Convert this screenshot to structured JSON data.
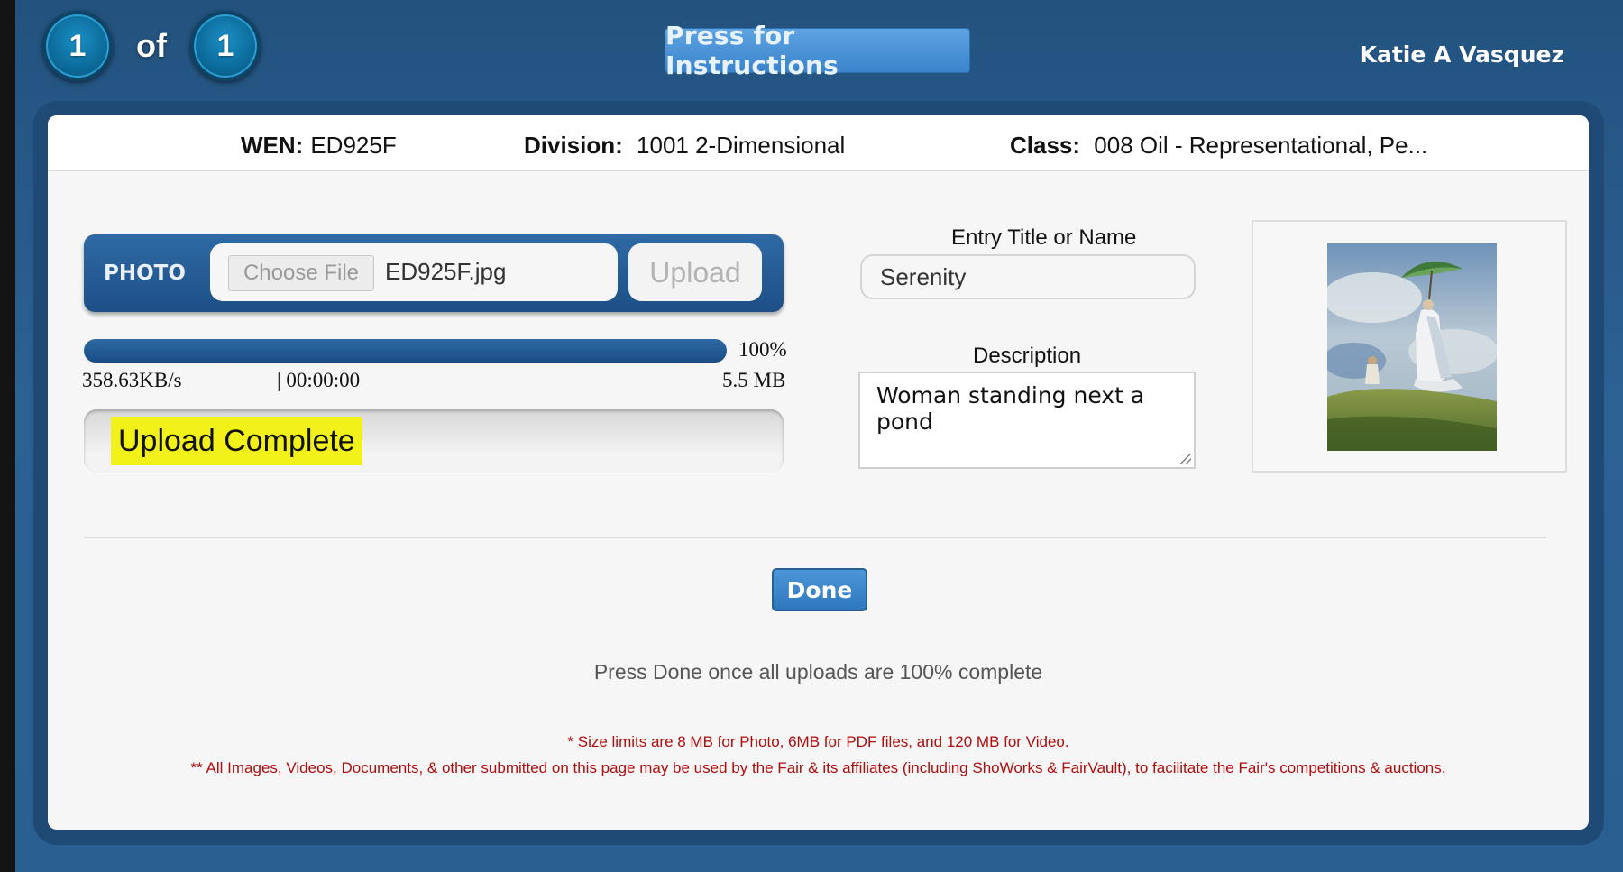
{
  "header": {
    "current_index": "1",
    "of_label": "of",
    "total_count": "1",
    "instructions_button": "Press for Instructions",
    "user_name": "Katie A Vasquez"
  },
  "entry_info": {
    "wen_label": "WEN:",
    "wen_value": "ED925F",
    "division_label": "Division:",
    "division_value": "1001 2-Dimensional",
    "class_label": "Class:",
    "class_value": "008 Oil - Representational, Pe..."
  },
  "upload": {
    "photo_label": "PHOTO",
    "choose_file_button": "Choose File",
    "file_name": "ED925F.jpg",
    "upload_button": "Upload",
    "progress_percent": "100%",
    "progress_fraction": 1.0,
    "speed": "358.63KB/s",
    "elapsed": "| 00:00:00",
    "file_size": "5.5 MB",
    "status": "Upload Complete",
    "status_highlight_color": "#f2f21a"
  },
  "form": {
    "title_label": "Entry Title or Name",
    "title_value": "Serenity",
    "description_label": "Description",
    "description_value": "Woman standing next a pond"
  },
  "preview": {
    "image_icon": "painting-thumbnail"
  },
  "actions": {
    "done_button": "Done",
    "hint": "Press Done once all uploads are 100% complete"
  },
  "notes": {
    "size_limits": "* Size limits are 8 MB for Photo, 6MB for PDF files, and 120 MB for Video.",
    "usage_notice": "** All Images, Videos, Documents, & other submitted on this page may be used by the Fair & its affiliates (including ShoWorks & FairVault), to facilitate the Fair's competitions & auctions."
  },
  "colors": {
    "brand_blue": "#2c6194",
    "button_blue": "#3b84cc",
    "note_red": "#b00d0d"
  }
}
